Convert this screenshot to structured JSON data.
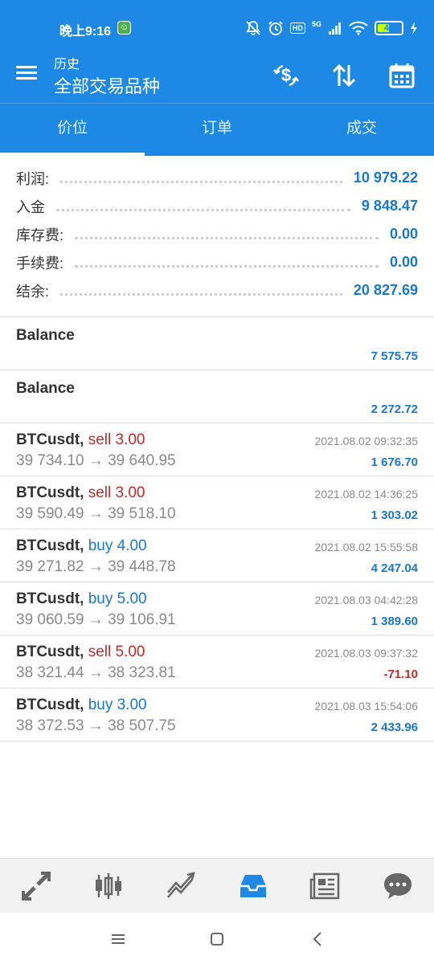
{
  "status_bar": {
    "time": "晚上9:16",
    "network": "5G",
    "hd_badge": "HD",
    "battery_level": "44",
    "icons": [
      "app-notification-icon",
      "bell-muted-icon",
      "alarm-icon",
      "hd-icon",
      "signal-icon",
      "wifi-icon",
      "battery-icon",
      "charging-icon"
    ]
  },
  "appbar": {
    "subtitle": "历史",
    "title": "全部交易品种",
    "actions": [
      "currency-exchange-icon",
      "sort-icon",
      "calendar-icon"
    ]
  },
  "tabs": [
    {
      "label": "价位",
      "active": true
    },
    {
      "label": "订单",
      "active": false
    },
    {
      "label": "成交",
      "active": false
    }
  ],
  "summary": [
    {
      "label": "利润:",
      "value": "10 979.22"
    },
    {
      "label": "入金",
      "value": "9 848.47"
    },
    {
      "label": "库存费:",
      "value": "0.00"
    },
    {
      "label": "手续费:",
      "value": "0.00"
    },
    {
      "label": "结余:",
      "value": "20 827.69"
    }
  ],
  "balances": [
    {
      "label": "Balance",
      "amount": "7 575.75"
    },
    {
      "label": "Balance",
      "amount": "2 272.72"
    }
  ],
  "deals": [
    {
      "symbol": "BTCusdt,",
      "action": "sell 3.00",
      "type": "sell",
      "prices": "39 734.10 → 39 640.95",
      "datetime": "2021.08.02 09:32:35",
      "profit": "1 676.70",
      "negative": false
    },
    {
      "symbol": "BTCusdt,",
      "action": "sell 3.00",
      "type": "sell",
      "prices": "39 590.49 → 39 518.10",
      "datetime": "2021.08.02 14:36:25",
      "profit": "1 303.02",
      "negative": false
    },
    {
      "symbol": "BTCusdt,",
      "action": "buy 4.00",
      "type": "buy",
      "prices": "39 271.82 → 39 448.78",
      "datetime": "2021.08.02 15:55:58",
      "profit": "4 247.04",
      "negative": false
    },
    {
      "symbol": "BTCusdt,",
      "action": "buy 5.00",
      "type": "buy",
      "prices": "39 060.59 → 39 106.91",
      "datetime": "2021.08.03 04:42:28",
      "profit": "1 389.60",
      "negative": false
    },
    {
      "symbol": "BTCusdt,",
      "action": "sell 5.00",
      "type": "sell",
      "prices": "38 321.44 → 38 323.81",
      "datetime": "2021.08.03 09:37:32",
      "profit": "-71.10",
      "negative": true
    },
    {
      "symbol": "BTCusdt,",
      "action": "buy 3.00",
      "type": "buy",
      "prices": "38 372.53 → 38 507.75",
      "datetime": "2021.08.03 15:54:06",
      "profit": "2 433.96",
      "negative": false
    }
  ],
  "bottom_nav": [
    "quotes-icon",
    "chart-icon",
    "trade-icon",
    "history-icon",
    "news-icon",
    "messages-icon"
  ],
  "bottom_nav_active": "history-icon",
  "colors": {
    "primary": "#1e88e5",
    "positive": "#1976d2",
    "negative": "#c62828",
    "muted": "#8a8a8a"
  }
}
